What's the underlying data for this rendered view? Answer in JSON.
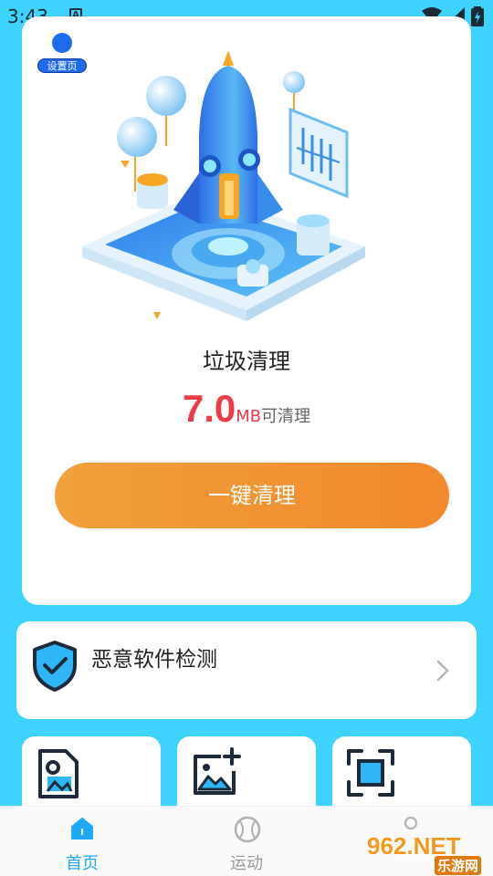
{
  "status_bar": {
    "time": "3:43",
    "notification_icon": "a-icon",
    "wifi_icon": "wifi-icon",
    "signal_icon": "signal-icon",
    "battery_icon": "battery-charging-icon"
  },
  "settings_badge": {
    "label": "设置页"
  },
  "cleaner": {
    "title": "垃圾清理",
    "size_value": "7.0",
    "size_unit": "MB",
    "size_suffix": "可清理",
    "button_label": "一键清理",
    "illustration": "rocket-isometric-illustration"
  },
  "malware": {
    "title": "恶意软件检测",
    "icon": "shield-check-icon",
    "chevron": "chevron-right-icon"
  },
  "tools": [
    {
      "icon": "document-image-icon"
    },
    {
      "icon": "image-add-icon"
    },
    {
      "icon": "scan-frame-icon"
    }
  ],
  "bottom_nav": {
    "items": [
      {
        "label": "首页",
        "icon": "home-icon",
        "active": true
      },
      {
        "label": "运动",
        "icon": "baseball-icon",
        "active": false
      },
      {
        "label": "",
        "icon": "user-icon",
        "active": false
      }
    ]
  },
  "watermark": {
    "main": "962.NET",
    "sub": "乐游网"
  },
  "colors": {
    "background": "#3DD3FE",
    "accent_red": "#EE3B45",
    "button_gradient_start": "#F0A03A",
    "button_gradient_end": "#F1892C",
    "nav_active": "#1FA8F7",
    "badge_blue": "#1E6BF0"
  }
}
